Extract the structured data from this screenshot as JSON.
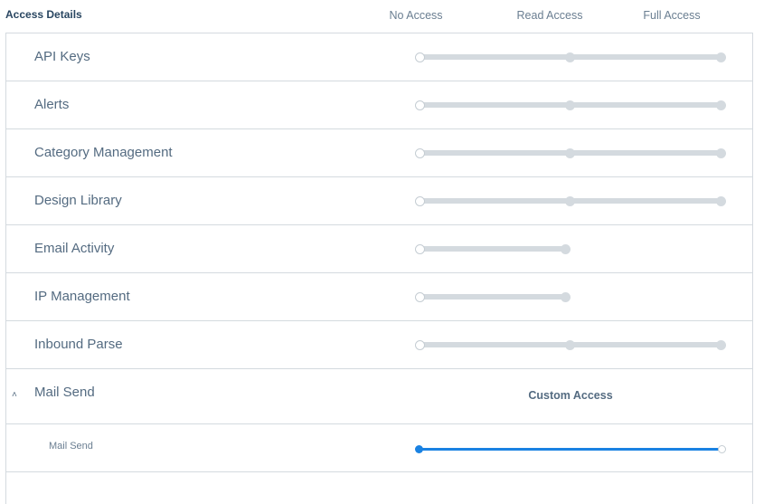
{
  "header": {
    "title": "Access Details",
    "levels": [
      "No Access",
      "Read Access",
      "Full Access"
    ]
  },
  "rows": [
    {
      "label": "API Keys",
      "stops": 3,
      "value": "No Access"
    },
    {
      "label": "Alerts",
      "stops": 3,
      "value": "No Access"
    },
    {
      "label": "Category Management",
      "stops": 3,
      "value": "No Access"
    },
    {
      "label": "Design Library",
      "stops": 3,
      "value": "No Access"
    },
    {
      "label": "Email Activity",
      "stops": 2,
      "value": "No Access"
    },
    {
      "label": "IP Management",
      "stops": 2,
      "value": "No Access"
    },
    {
      "label": "Inbound Parse",
      "stops": 3,
      "value": "No Access"
    }
  ],
  "expanded": {
    "label": "Mail Send",
    "status": "Custom Access",
    "expanded": true,
    "children": [
      {
        "label": "Mail Send",
        "stops": 2,
        "value": "No Access"
      }
    ]
  },
  "colors": {
    "track": "#d4dadf",
    "accent": "#1a82e2",
    "text": "#546b81"
  },
  "icons": {
    "collapse": "chevron-up-icon"
  }
}
